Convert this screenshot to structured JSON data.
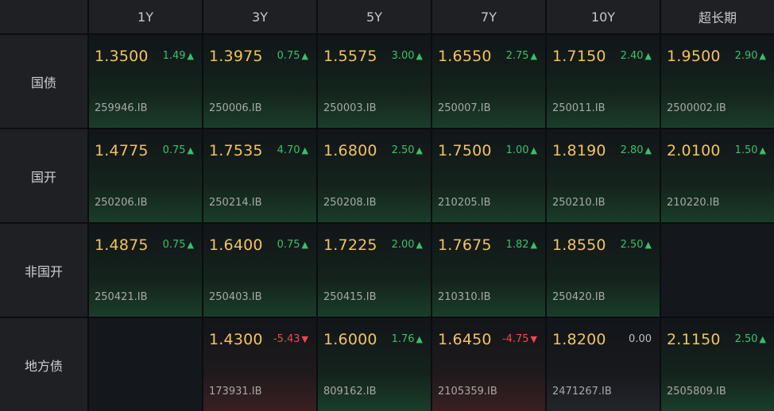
{
  "columns": [
    "1Y",
    "3Y",
    "5Y",
    "7Y",
    "10Y",
    "超长期"
  ],
  "rows": [
    {
      "label": "国债",
      "cells": [
        {
          "rate": "1.3500",
          "change": "1.49",
          "dir": "up",
          "code": "259946.IB"
        },
        {
          "rate": "1.3975",
          "change": "0.75",
          "dir": "up",
          "code": "250006.IB"
        },
        {
          "rate": "1.5575",
          "change": "3.00",
          "dir": "up",
          "code": "250003.IB"
        },
        {
          "rate": "1.6550",
          "change": "2.75",
          "dir": "up",
          "code": "250007.IB"
        },
        {
          "rate": "1.7150",
          "change": "2.40",
          "dir": "up",
          "code": "250011.IB"
        },
        {
          "rate": "1.9500",
          "change": "2.90",
          "dir": "up",
          "code": "2500002.IB"
        }
      ]
    },
    {
      "label": "国开",
      "cells": [
        {
          "rate": "1.4775",
          "change": "0.75",
          "dir": "up",
          "code": "250206.IB"
        },
        {
          "rate": "1.7535",
          "change": "4.70",
          "dir": "up",
          "code": "250214.IB"
        },
        {
          "rate": "1.6800",
          "change": "2.50",
          "dir": "up",
          "code": "250208.IB"
        },
        {
          "rate": "1.7500",
          "change": "1.00",
          "dir": "up",
          "code": "210205.IB"
        },
        {
          "rate": "1.8190",
          "change": "2.80",
          "dir": "up",
          "code": "250210.IB"
        },
        {
          "rate": "2.0100",
          "change": "1.50",
          "dir": "up",
          "code": "210220.IB"
        }
      ]
    },
    {
      "label": "非国开",
      "cells": [
        {
          "rate": "1.4875",
          "change": "0.75",
          "dir": "up",
          "code": "250421.IB"
        },
        {
          "rate": "1.6400",
          "change": "0.75",
          "dir": "up",
          "code": "250403.IB"
        },
        {
          "rate": "1.7225",
          "change": "2.00",
          "dir": "up",
          "code": "250415.IB"
        },
        {
          "rate": "1.7675",
          "change": "1.82",
          "dir": "up",
          "code": "210310.IB"
        },
        {
          "rate": "1.8550",
          "change": "2.50",
          "dir": "up",
          "code": "250420.IB"
        },
        null
      ]
    },
    {
      "label": "地方债",
      "cells": [
        null,
        {
          "rate": "1.4300",
          "change": "-5.43",
          "dir": "down",
          "code": "173931.IB"
        },
        {
          "rate": "1.6000",
          "change": "1.76",
          "dir": "up",
          "code": "809162.IB"
        },
        {
          "rate": "1.6450",
          "change": "-4.75",
          "dir": "down",
          "code": "2105359.IB"
        },
        {
          "rate": "1.8200",
          "change": "0.00",
          "dir": "flat",
          "code": "2471267.IB"
        },
        {
          "rate": "2.1150",
          "change": "2.50",
          "dir": "up",
          "code": "2505809.IB"
        }
      ]
    }
  ],
  "colors": {
    "rate": "#f2c25f",
    "up": "#39c06a",
    "down": "#f0474f",
    "flat": "#bfbfbf"
  },
  "icons": {
    "up": "triangle-up-icon",
    "down": "triangle-down-icon"
  }
}
